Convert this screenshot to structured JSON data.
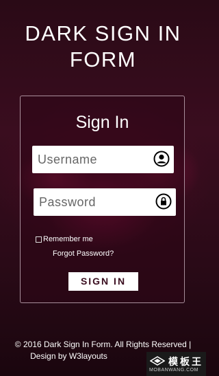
{
  "page": {
    "title_line1": "DARK SIGN IN",
    "title_line2": "FORM"
  },
  "form": {
    "heading": "Sign In",
    "username_placeholder": "Username",
    "password_placeholder": "Password",
    "username_icon": "user-icon",
    "password_icon": "lock-icon",
    "remember_label": "Remember me",
    "forgot_link": "Forgot Password?",
    "submit_label": "SIGN IN"
  },
  "footer": {
    "line1": "© 2016 Dark Sign In Form. All Rights Reserved |",
    "line2": "Design by W3layouts"
  },
  "watermark": {
    "name_cn": "模板王",
    "name_en": "MOBANWANG.COM"
  },
  "colors": {
    "background": "#2a0a16",
    "accent": "#3a0d1f",
    "text": "#ffffff"
  }
}
